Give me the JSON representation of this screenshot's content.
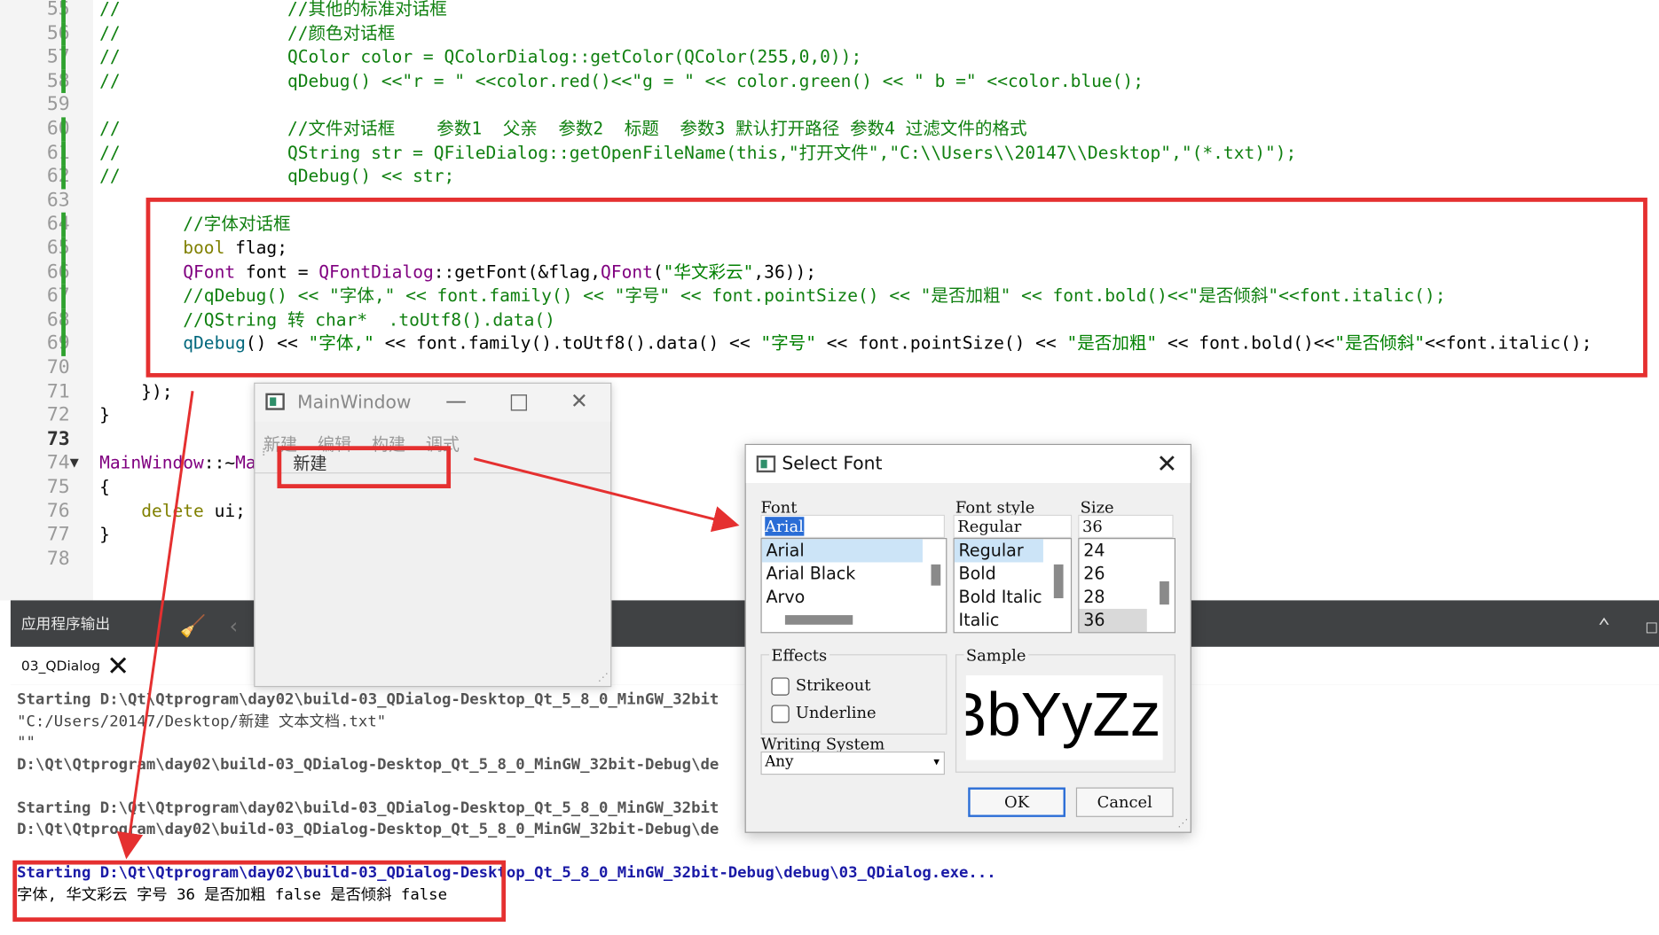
{
  "editor": {
    "lines": [
      {
        "n": "55",
        "mod": true,
        "segs": [
          [
            "c-cmt",
            "//                //其他的标准对话框"
          ]
        ]
      },
      {
        "n": "56",
        "mod": true,
        "segs": [
          [
            "c-cmt",
            "//                //颜色对话框"
          ]
        ]
      },
      {
        "n": "57",
        "mod": true,
        "segs": [
          [
            "c-cmt",
            "//                QColor color = QColorDialog::getColor(QColor(255,0,0));"
          ]
        ]
      },
      {
        "n": "58",
        "mod": true,
        "segs": [
          [
            "c-cmt",
            "//                qDebug() <<\"r = \" <<color.red()<<\"g = \" << color.green() << \" b =\" <<color.blue();"
          ]
        ]
      },
      {
        "n": "59",
        "mod": false,
        "segs": []
      },
      {
        "n": "60",
        "mod": true,
        "segs": [
          [
            "c-cmt",
            "//                //文件对话框    参数1  父亲  参数2  标题  参数3 默认打开路径 参数4 过滤文件的格式"
          ]
        ]
      },
      {
        "n": "61",
        "mod": true,
        "segs": [
          [
            "c-cmt",
            "//                QString str = QFileDialog::getOpenFileName(this,\"打开文件\",\"C:\\\\Users\\\\20147\\\\Desktop\",\"(*.txt)\");"
          ]
        ]
      },
      {
        "n": "62",
        "mod": true,
        "segs": [
          [
            "c-cmt",
            "//                qDebug() << str;"
          ]
        ]
      },
      {
        "n": "63",
        "mod": false,
        "segs": []
      },
      {
        "n": "64",
        "mod": true,
        "segs": [
          [
            "c-pl",
            "        "
          ],
          [
            "c-cmt",
            "//字体对话框"
          ]
        ]
      },
      {
        "n": "65",
        "mod": true,
        "segs": [
          [
            "c-pl",
            "        "
          ],
          [
            "c-kw",
            "bool"
          ],
          [
            "c-pl",
            " flag;"
          ]
        ]
      },
      {
        "n": "66",
        "mod": true,
        "segs": [
          [
            "c-pl",
            "        "
          ],
          [
            "c-typ",
            "QFont"
          ],
          [
            "c-pl",
            " font = "
          ],
          [
            "c-typ",
            "QFontDialog"
          ],
          [
            "c-pl",
            "::getFont(&flag,"
          ],
          [
            "c-typ",
            "QFont"
          ],
          [
            "c-pl",
            "("
          ],
          [
            "c-str",
            "\"华文彩云\""
          ],
          [
            "c-pl",
            ",36));"
          ]
        ]
      },
      {
        "n": "67",
        "mod": true,
        "segs": [
          [
            "c-pl",
            "        "
          ],
          [
            "c-cmt",
            "//qDebug() << \"字体,\" << font.family() << \"字号\" << font.pointSize() << \"是否加粗\" << font.bold()<<\"是否倾斜\"<<font.italic();"
          ]
        ]
      },
      {
        "n": "68",
        "mod": true,
        "segs": [
          [
            "c-pl",
            "        "
          ],
          [
            "c-cmt",
            "//QString 转 char*  .toUtf8().data()"
          ]
        ]
      },
      {
        "n": "69",
        "mod": true,
        "segs": [
          [
            "c-pl",
            "        "
          ],
          [
            "c-fn",
            "qDebug"
          ],
          [
            "c-pl",
            "() << "
          ],
          [
            "c-str",
            "\"字体,\""
          ],
          [
            "c-pl",
            " << font.family().toUtf8().data() << "
          ],
          [
            "c-str",
            "\"字号\""
          ],
          [
            "c-pl",
            " << font.pointSize() << "
          ],
          [
            "c-str",
            "\"是否加粗\""
          ],
          [
            "c-pl",
            " << font.bold()<<"
          ],
          [
            "c-str",
            "\"是否倾斜\""
          ],
          [
            "c-pl",
            "<<font.italic();"
          ]
        ]
      },
      {
        "n": "70",
        "mod": false,
        "segs": []
      },
      {
        "n": "71",
        "mod": false,
        "segs": [
          [
            "c-pl",
            "    });"
          ]
        ]
      },
      {
        "n": "72",
        "mod": false,
        "segs": [
          [
            "c-pl",
            "}"
          ]
        ]
      },
      {
        "n": "73",
        "mod": false,
        "cur": true,
        "segs": []
      },
      {
        "n": "74",
        "mod": false,
        "fold": true,
        "segs": [
          [
            "c-typ",
            "MainWindow"
          ],
          [
            "c-pl",
            "::~"
          ],
          [
            "c-typ",
            "Ma"
          ]
        ]
      },
      {
        "n": "75",
        "mod": false,
        "segs": [
          [
            "c-pl",
            "{"
          ]
        ]
      },
      {
        "n": "76",
        "mod": false,
        "segs": [
          [
            "c-pl",
            "    "
          ],
          [
            "c-kw",
            "delete"
          ],
          [
            "c-pl",
            " ui;"
          ]
        ]
      },
      {
        "n": "77",
        "mod": false,
        "segs": [
          [
            "c-pl",
            "}"
          ]
        ]
      },
      {
        "n": "78",
        "mod": false,
        "segs": []
      }
    ]
  },
  "output": {
    "panel_title": "应用程序输出",
    "tab_label": "03_QDialog",
    "lines": [
      {
        "cls": "bold",
        "text": "Starting D:\\Qt\\Qtprogram\\day02\\build-03_QDialog-Desktop_Qt_5_8_0_MinGW_32bit"
      },
      {
        "cls": "",
        "text": "\"C:/Users/20147/Desktop/新建 文本文档.txt\""
      },
      {
        "cls": "",
        "text": "\"\""
      },
      {
        "cls": "bold",
        "text": "D:\\Qt\\Qtprogram\\day02\\build-03_QDialog-Desktop_Qt_5_8_0_MinGW_32bit-Debug\\de"
      },
      {
        "cls": "",
        "text": ""
      },
      {
        "cls": "bold",
        "text": "Starting D:\\Qt\\Qtprogram\\day02\\build-03_QDialog-Desktop_Qt_5_8_0_MinGW_32bit"
      },
      {
        "cls": "bold",
        "text": "D:\\Qt\\Qtprogram\\day02\\build-03_QDialog-Desktop_Qt_5_8_0_MinGW_32bit-Debug\\de"
      },
      {
        "cls": "",
        "text": ""
      },
      {
        "cls": "blue",
        "text": "Starting D:\\Qt\\Qtprogram\\day02\\build-03_QDialog-Desktop_Qt_5_8_0_MinGW_32bit-Debug\\debug\\03_QDialog.exe..."
      },
      {
        "cls": "black",
        "text": "字体, 华文彩云 字号 36 是否加粗 false 是否倾斜 false"
      }
    ]
  },
  "main_window": {
    "title": "MainWindow",
    "menu": [
      "新建",
      "编辑",
      "构建",
      "调式"
    ],
    "toolbar_action": "新建"
  },
  "font_dialog": {
    "title": "Select Font",
    "font_label": "Font",
    "font_value": "Arial",
    "fonts": [
      "Arial",
      "Arial Black",
      "Arvo"
    ],
    "style_label": "Font style",
    "style_value": "Regular",
    "styles": [
      "Regular",
      "Bold",
      "Bold Italic",
      "Italic"
    ],
    "size_label": "Size",
    "size_value": "36",
    "sizes": [
      "24",
      "26",
      "28",
      "36"
    ],
    "effects_label": "Effects",
    "strikeout_label": "Strikeout",
    "underline_label": "Underline",
    "sample_label": "Sample",
    "sample_text": "AaBbYyZz",
    "writing_system_label": "Writing System",
    "writing_system_value": "Any",
    "ok_label": "OK",
    "cancel_label": "Cancel"
  },
  "colors": {
    "annotation_red": "#e53030",
    "selection_blue": "#cce4f7",
    "modified_green": "#2fa12f"
  }
}
